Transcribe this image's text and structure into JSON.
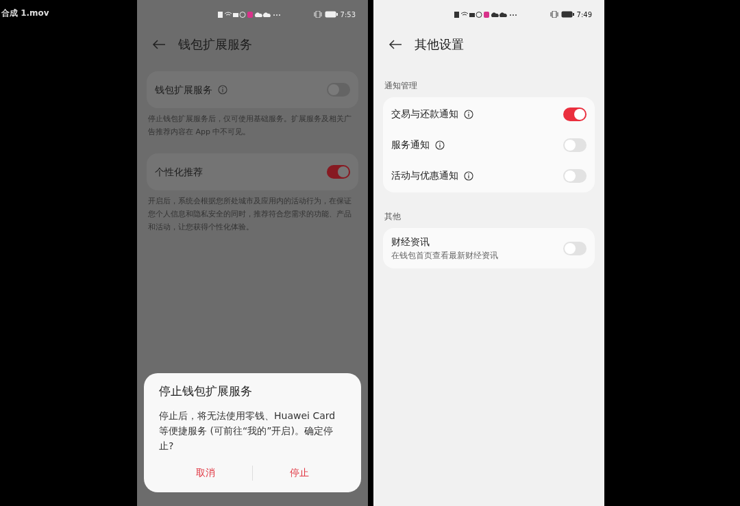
{
  "file_label": "合成 1.mov",
  "screens": [
    {
      "dimmed": true,
      "time": "7:53",
      "title": "钱包扩展服务",
      "groups": [
        {
          "items": [
            {
              "label": "钱包扩展服务",
              "info": true,
              "on": false
            }
          ],
          "note": "停止钱包扩展服务后，仅可使用基础服务。扩展服务及相关广告推荐内容在 App 中不可见。"
        },
        {
          "items": [
            {
              "label": "个性化推荐",
              "info": false,
              "on": true
            }
          ],
          "note": "开启后，系统会根据您所处城市及应用内的活动行为，在保证您个人信息和隐私安全的同时，推荐符合您需求的功能、产品和活动，让您获得个性化体验。"
        }
      ],
      "dialog": {
        "title": "停止钱包扩展服务",
        "message": "停止后，将无法使用零钱、Huawei Card 等便捷服务 (可前往“我的”开启)。确定停止?",
        "buttons": [
          "取消",
          "停止"
        ]
      }
    },
    {
      "dimmed": false,
      "time": "7:49",
      "title": "其他设置",
      "groups": [
        {
          "header": "通知管理",
          "items": [
            {
              "label": "交易与还款通知",
              "info": true,
              "on": true
            },
            {
              "label": "服务通知",
              "info": true,
              "on": false
            },
            {
              "label": "活动与优惠通知",
              "info": true,
              "on": false
            }
          ]
        },
        {
          "header": "其他",
          "items": [
            {
              "label": "财经资讯",
              "subtitle": "在钱包首页查看最新财经资讯",
              "info": false,
              "on": false
            }
          ]
        }
      ]
    }
  ]
}
